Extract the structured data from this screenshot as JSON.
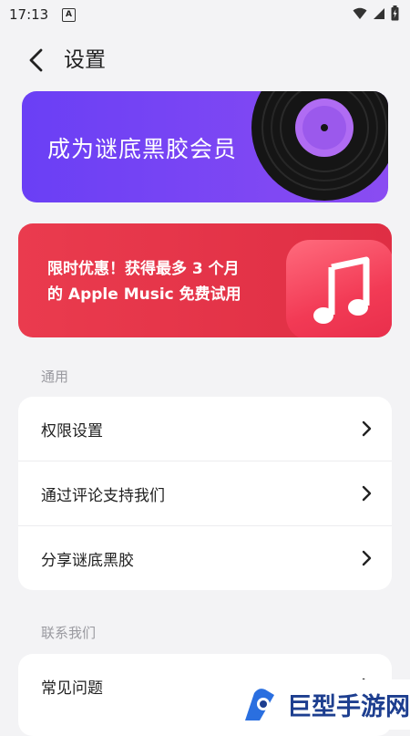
{
  "status_bar": {
    "time": "17:13",
    "notification_letter": "A"
  },
  "header": {
    "title": "设置"
  },
  "vip_banner": {
    "text": "成为谜底黑胶会员"
  },
  "apple_banner": {
    "line1": "限时优惠！获得最多 3 个月",
    "line2": "的 Apple Music 免费试用"
  },
  "sections": {
    "general": {
      "label": "通用",
      "items": [
        {
          "label": "权限设置"
        },
        {
          "label": "通过评论支持我们"
        },
        {
          "label": "分享谜底黑胶"
        }
      ]
    },
    "contact": {
      "label": "联系我们",
      "items": [
        {
          "label": "常见问题"
        }
      ]
    }
  },
  "watermark": {
    "text": "巨型手游网"
  },
  "colors": {
    "background": "#f3f3f5",
    "vip_purple": "#7b46f4",
    "apple_red": "#e5364b",
    "watermark_blue": "#1d3e8f"
  }
}
